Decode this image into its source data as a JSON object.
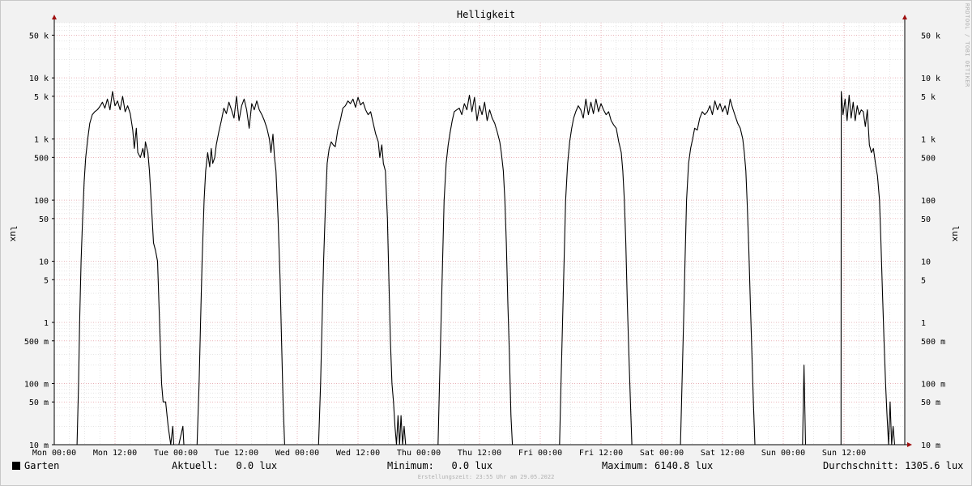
{
  "chart_data": {
    "type": "line",
    "title": "Helligkeit",
    "ylabel": "lux",
    "yscale": "log",
    "ylim": [
      0.01,
      80000
    ],
    "y_ticks": [
      {
        "value": 50000,
        "label": "50 k",
        "major": true
      },
      {
        "value": 10000,
        "label": "10 k",
        "major": true
      },
      {
        "value": 5000,
        "label": "5 k",
        "major": true
      },
      {
        "value": 1000,
        "label": "1 k",
        "major": true
      },
      {
        "value": 500,
        "label": "500",
        "major": true
      },
      {
        "value": 100,
        "label": "100",
        "major": true
      },
      {
        "value": 50,
        "label": "50",
        "major": true
      },
      {
        "value": 10,
        "label": "10",
        "major": true
      },
      {
        "value": 5,
        "label": "5",
        "major": true
      },
      {
        "value": 1,
        "label": "1",
        "major": true
      },
      {
        "value": 0.5,
        "label": "500 m",
        "major": true
      },
      {
        "value": 0.1,
        "label": "100 m",
        "major": true
      },
      {
        "value": 0.05,
        "label": "50 m",
        "major": true
      },
      {
        "value": 0.01,
        "label": "10 m",
        "major": true
      }
    ],
    "x_unit": "hours since Mon 00:00",
    "xlim": [
      0,
      168
    ],
    "x_ticks": [
      {
        "value": 0,
        "label": "Mon 00:00"
      },
      {
        "value": 12,
        "label": "Mon 12:00"
      },
      {
        "value": 24,
        "label": "Tue 00:00"
      },
      {
        "value": 36,
        "label": "Tue 12:00"
      },
      {
        "value": 48,
        "label": "Wed 00:00"
      },
      {
        "value": 60,
        "label": "Wed 12:00"
      },
      {
        "value": 72,
        "label": "Thu 00:00"
      },
      {
        "value": 84,
        "label": "Thu 12:00"
      },
      {
        "value": 96,
        "label": "Fri 00:00"
      },
      {
        "value": 108,
        "label": "Fri 12:00"
      },
      {
        "value": 120,
        "label": "Sat 00:00"
      },
      {
        "value": 132,
        "label": "Sat 12:00"
      },
      {
        "value": 144,
        "label": "Sun 00:00"
      },
      {
        "value": 156,
        "label": "Sun 12:00"
      }
    ],
    "grid": true,
    "series": [
      {
        "name": "Garten",
        "color": "#000000",
        "points": [
          [
            4.5,
            0.01
          ],
          [
            4.8,
            0.1
          ],
          [
            5.0,
            1
          ],
          [
            5.3,
            10
          ],
          [
            5.6,
            50
          ],
          [
            5.9,
            200
          ],
          [
            6.2,
            500
          ],
          [
            6.6,
            1000
          ],
          [
            7,
            1800
          ],
          [
            7.5,
            2500
          ],
          [
            8,
            2800
          ],
          [
            8.5,
            3000
          ],
          [
            9,
            3400
          ],
          [
            9.5,
            4000
          ],
          [
            10,
            3200
          ],
          [
            10.5,
            4500
          ],
          [
            11,
            3000
          ],
          [
            11.5,
            6000
          ],
          [
            12,
            3500
          ],
          [
            12.5,
            4200
          ],
          [
            13,
            3000
          ],
          [
            13.5,
            5000
          ],
          [
            14,
            2800
          ],
          [
            14.5,
            3500
          ],
          [
            15,
            2600
          ],
          [
            15.5,
            1400
          ],
          [
            15.8,
            700
          ],
          [
            16.2,
            1500
          ],
          [
            16.5,
            600
          ],
          [
            17,
            500
          ],
          [
            17.5,
            700
          ],
          [
            17.8,
            500
          ],
          [
            18,
            900
          ],
          [
            18.5,
            600
          ],
          [
            18.8,
            300
          ],
          [
            19.2,
            80
          ],
          [
            19.6,
            20
          ],
          [
            20,
            15
          ],
          [
            20.4,
            10
          ],
          [
            20.8,
            1
          ],
          [
            21.2,
            0.1
          ],
          [
            21.5,
            0.05
          ],
          [
            22,
            0.05
          ],
          [
            22.5,
            0.02
          ],
          [
            23,
            0.01
          ],
          [
            23.4,
            0.02
          ],
          [
            23.6,
            0.01
          ],
          [
            24,
            0.01
          ],
          [
            24.6,
            0.01
          ],
          [
            25.4,
            0.02
          ],
          [
            25.6,
            0.01
          ],
          [
            28.2,
            0.01
          ],
          [
            28.6,
            0.1
          ],
          [
            28.9,
            1
          ],
          [
            29.2,
            10
          ],
          [
            29.6,
            100
          ],
          [
            29.9,
            300
          ],
          [
            30.3,
            600
          ],
          [
            30.7,
            350
          ],
          [
            31.0,
            700
          ],
          [
            31.3,
            400
          ],
          [
            31.7,
            500
          ],
          [
            32,
            800
          ],
          [
            32.5,
            1300
          ],
          [
            33,
            2000
          ],
          [
            33.5,
            3200
          ],
          [
            34,
            2600
          ],
          [
            34.5,
            4000
          ],
          [
            35,
            3000
          ],
          [
            35.5,
            2200
          ],
          [
            36,
            5000
          ],
          [
            36.5,
            2000
          ],
          [
            37,
            3500
          ],
          [
            37.5,
            4500
          ],
          [
            38,
            3000
          ],
          [
            38.5,
            1500
          ],
          [
            39,
            3800
          ],
          [
            39.5,
            3000
          ],
          [
            40,
            4200
          ],
          [
            40.5,
            3000
          ],
          [
            41,
            2500
          ],
          [
            41.5,
            2000
          ],
          [
            42,
            1500
          ],
          [
            42.5,
            1000
          ],
          [
            42.8,
            600
          ],
          [
            43.2,
            1200
          ],
          [
            43.5,
            500
          ],
          [
            43.8,
            300
          ],
          [
            44.2,
            50
          ],
          [
            44.6,
            5
          ],
          [
            44.9,
            0.5
          ],
          [
            45.2,
            0.05
          ],
          [
            45.5,
            0.01
          ],
          [
            52.2,
            0.01
          ],
          [
            52.6,
            0.1
          ],
          [
            52.9,
            1
          ],
          [
            53.2,
            10
          ],
          [
            53.6,
            100
          ],
          [
            53.9,
            400
          ],
          [
            54.3,
            700
          ],
          [
            54.7,
            900
          ],
          [
            55.1,
            800
          ],
          [
            55.5,
            750
          ],
          [
            56,
            1400
          ],
          [
            56.5,
            2000
          ],
          [
            57,
            3200
          ],
          [
            57.5,
            3500
          ],
          [
            58,
            4200
          ],
          [
            58.5,
            3800
          ],
          [
            59,
            4500
          ],
          [
            59.5,
            3300
          ],
          [
            60,
            4800
          ],
          [
            60.5,
            3600
          ],
          [
            61,
            4000
          ],
          [
            61.5,
            3000
          ],
          [
            62,
            2500
          ],
          [
            62.5,
            2800
          ],
          [
            63,
            1800
          ],
          [
            63.5,
            1200
          ],
          [
            64,
            900
          ],
          [
            64.3,
            500
          ],
          [
            64.7,
            800
          ],
          [
            65,
            400
          ],
          [
            65.4,
            300
          ],
          [
            65.8,
            50
          ],
          [
            66.1,
            5
          ],
          [
            66.4,
            0.5
          ],
          [
            66.7,
            0.1
          ],
          [
            67,
            0.05
          ],
          [
            67.3,
            0.02
          ],
          [
            67.6,
            0.01
          ],
          [
            67.9,
            0.03
          ],
          [
            68.2,
            0.01
          ],
          [
            68.5,
            0.03
          ],
          [
            68.8,
            0.01
          ],
          [
            69.1,
            0.02
          ],
          [
            69.4,
            0.01
          ],
          [
            75.8,
            0.01
          ],
          [
            76.1,
            0.1
          ],
          [
            76.4,
            1
          ],
          [
            76.7,
            10
          ],
          [
            77.0,
            100
          ],
          [
            77.4,
            400
          ],
          [
            77.8,
            800
          ],
          [
            78.2,
            1300
          ],
          [
            78.6,
            2000
          ],
          [
            79,
            2800
          ],
          [
            79.5,
            3000
          ],
          [
            80,
            3200
          ],
          [
            80.5,
            2500
          ],
          [
            81,
            3800
          ],
          [
            81.5,
            3000
          ],
          [
            82,
            5200
          ],
          [
            82.5,
            2800
          ],
          [
            83,
            4800
          ],
          [
            83.5,
            2000
          ],
          [
            84,
            3500
          ],
          [
            84.5,
            2500
          ],
          [
            85,
            4000
          ],
          [
            85.5,
            2000
          ],
          [
            86,
            3000
          ],
          [
            86.5,
            2200
          ],
          [
            87,
            1800
          ],
          [
            87.5,
            1300
          ],
          [
            88,
            900
          ],
          [
            88.3,
            600
          ],
          [
            88.7,
            300
          ],
          [
            89,
            100
          ],
          [
            89.3,
            20
          ],
          [
            89.6,
            2
          ],
          [
            89.9,
            0.3
          ],
          [
            90.2,
            0.03
          ],
          [
            90.5,
            0.01
          ],
          [
            99.8,
            0.01
          ],
          [
            100.1,
            0.1
          ],
          [
            100.4,
            1
          ],
          [
            100.7,
            10
          ],
          [
            101.0,
            100
          ],
          [
            101.4,
            400
          ],
          [
            101.8,
            900
          ],
          [
            102.2,
            1500
          ],
          [
            102.6,
            2200
          ],
          [
            103,
            2800
          ],
          [
            103.5,
            3500
          ],
          [
            104,
            3000
          ],
          [
            104.5,
            2200
          ],
          [
            105,
            4500
          ],
          [
            105.5,
            2500
          ],
          [
            106,
            4000
          ],
          [
            106.5,
            2600
          ],
          [
            107,
            4500
          ],
          [
            107.5,
            2800
          ],
          [
            108,
            3800
          ],
          [
            108.5,
            3000
          ],
          [
            109,
            2500
          ],
          [
            109.5,
            2800
          ],
          [
            110,
            2000
          ],
          [
            110.5,
            1700
          ],
          [
            111,
            1500
          ],
          [
            111.5,
            900
          ],
          [
            112,
            600
          ],
          [
            112.3,
            300
          ],
          [
            112.6,
            100
          ],
          [
            112.9,
            20
          ],
          [
            113.2,
            2
          ],
          [
            113.5,
            0.3
          ],
          [
            113.8,
            0.05
          ],
          [
            114.1,
            0.01
          ],
          [
            123.7,
            0.01
          ],
          [
            124.0,
            0.1
          ],
          [
            124.3,
            1
          ],
          [
            124.6,
            10
          ],
          [
            124.9,
            100
          ],
          [
            125.3,
            400
          ],
          [
            125.7,
            700
          ],
          [
            126.1,
            1000
          ],
          [
            126.5,
            1500
          ],
          [
            127,
            1400
          ],
          [
            127.5,
            2200
          ],
          [
            128,
            2800
          ],
          [
            128.5,
            2500
          ],
          [
            129,
            2800
          ],
          [
            129.5,
            3500
          ],
          [
            130,
            2500
          ],
          [
            130.5,
            4200
          ],
          [
            131,
            3000
          ],
          [
            131.5,
            3800
          ],
          [
            132,
            2800
          ],
          [
            132.5,
            3500
          ],
          [
            133,
            2500
          ],
          [
            133.5,
            4500
          ],
          [
            134,
            3200
          ],
          [
            134.5,
            2400
          ],
          [
            135,
            1800
          ],
          [
            135.5,
            1500
          ],
          [
            136,
            1000
          ],
          [
            136.3,
            600
          ],
          [
            136.6,
            300
          ],
          [
            136.9,
            80
          ],
          [
            137.2,
            15
          ],
          [
            137.5,
            2
          ],
          [
            137.8,
            0.3
          ],
          [
            138.1,
            0.05
          ],
          [
            138.4,
            0.01
          ],
          [
            147.8,
            0.01
          ],
          [
            148.1,
            0.2
          ],
          [
            148.4,
            0.01
          ],
          [
            155.4,
            0.01
          ],
          [
            155.45,
            6000
          ],
          [
            155.8,
            2500
          ],
          [
            156.2,
            4500
          ],
          [
            156.6,
            2000
          ],
          [
            157,
            5200
          ],
          [
            157.4,
            2200
          ],
          [
            157.8,
            4000
          ],
          [
            158.2,
            2000
          ],
          [
            158.6,
            3500
          ],
          [
            159,
            2500
          ],
          [
            159.4,
            3000
          ],
          [
            159.8,
            2800
          ],
          [
            160.2,
            1600
          ],
          [
            160.6,
            3000
          ],
          [
            161,
            800
          ],
          [
            161.4,
            600
          ],
          [
            161.8,
            700
          ],
          [
            162.2,
            400
          ],
          [
            162.6,
            250
          ],
          [
            163,
            100
          ],
          [
            163.3,
            20
          ],
          [
            163.6,
            3
          ],
          [
            163.9,
            0.5
          ],
          [
            164.2,
            0.1
          ],
          [
            164.5,
            0.03
          ],
          [
            164.8,
            0.01
          ],
          [
            165.1,
            0.05
          ],
          [
            165.4,
            0.01
          ],
          [
            165.7,
            0.02
          ],
          [
            166.0,
            0.01
          ]
        ]
      }
    ]
  },
  "legend": {
    "series_name": "Garten",
    "current_label": "Aktuell:",
    "current_value": "0.0 lux",
    "min_label": "Minimum:",
    "min_value": "0.0 lux",
    "max_label": "Maximum:",
    "max_value": "6140.8 lux",
    "avg_label": "Durchschnitt:",
    "avg_value": "1305.6 lux"
  },
  "watermark": "RRDTOOL / TOBI OETIKER",
  "footer": "Erstellungszeit: 23:55 Uhr am 29.05.2022",
  "colors": {
    "background": "#f2f2f2",
    "plot_background": "#ffffff",
    "grid_major": "#e8a0a8",
    "grid_minor": "#d6d6d6",
    "line": "#000000",
    "arrow": "#a01010"
  }
}
